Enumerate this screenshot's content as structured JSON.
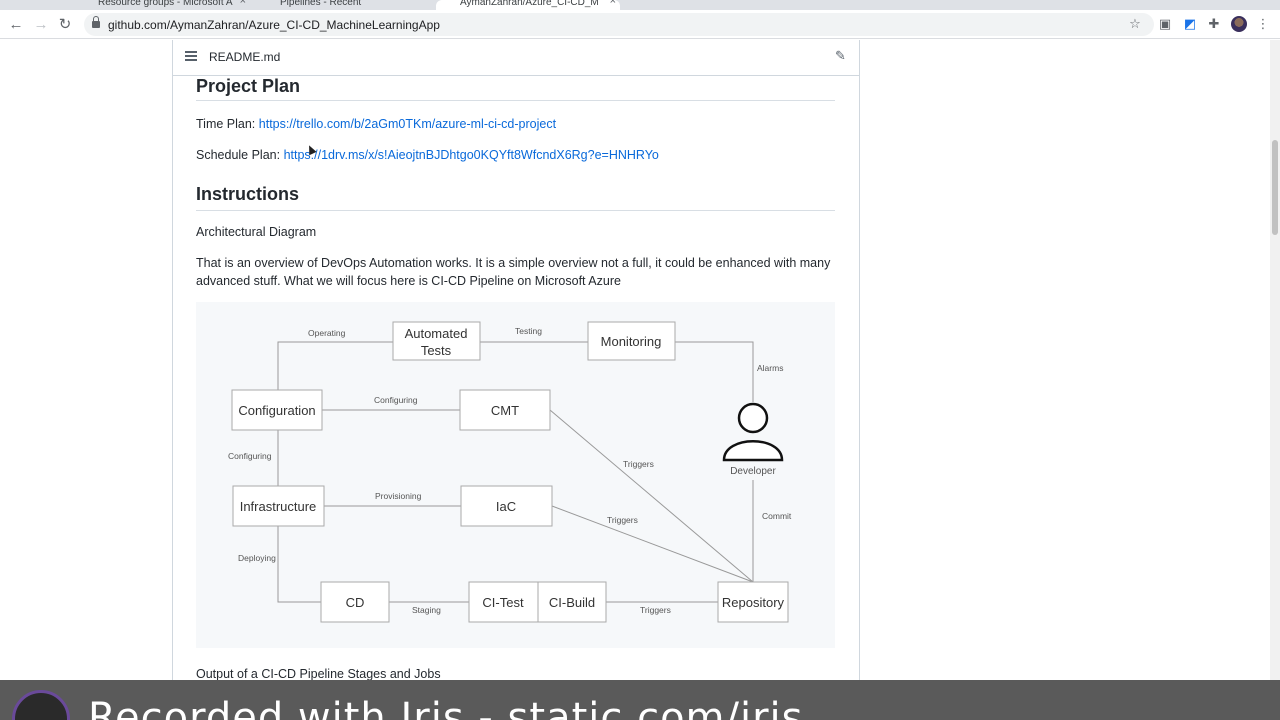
{
  "tabs": [
    {
      "label": "Resource groups - Microsoft A"
    },
    {
      "label": "Pipelines - Recent"
    },
    {
      "label": "AymanZahran/Azure_CI-CD_M"
    }
  ],
  "browser": {
    "url": "github.com/AymanZahran/Azure_CI-CD_MachineLearningApp"
  },
  "readme": {
    "filename": "README.md"
  },
  "sections": {
    "project_plan_heading": "Project Plan",
    "time_plan_label": "Time Plan: ",
    "time_plan_link": "https://trello.com/b/2aGm0TKm/azure-ml-ci-cd-project",
    "schedule_plan_label": "Schedule Plan: ",
    "schedule_plan_link": "https://1drv.ms/x/s!AieojtnBJDhtgo0KQYft8WfcndX6Rg?e=HNHRYo",
    "instructions_heading": "Instructions",
    "arch_diagram_label": "Architectural Diagram",
    "overview_text": "That is an overview of DevOps Automation works. It is a simple overview not a full, it could be enhanced with many advanced stuff. What we will focus here is CI-CD Pipeline on Microsoft Azure",
    "output_label": "Output of a CI-CD Pipeline Stages and Jobs"
  },
  "diagram": {
    "nodes": {
      "automated_tests_1": "Automated",
      "automated_tests_2": "Tests",
      "monitoring": "Monitoring",
      "configuration": "Configuration",
      "cmt": "CMT",
      "developer": "Developer",
      "infrastructure": "Infrastructure",
      "iac": "IaC",
      "cd": "CD",
      "ci_test": "CI-Test",
      "ci_build": "CI-Build",
      "repository": "Repository"
    },
    "edges": {
      "operating": "Operating",
      "testing": "Testing",
      "alarms": "Alarms",
      "configuring_1": "Configuring",
      "configuring_2": "Configuring",
      "triggers_1": "Triggers",
      "triggers_2": "Triggers",
      "triggers_3": "Triggers",
      "provisioning": "Provisioning",
      "commit": "Commit",
      "deploying": "Deploying",
      "staging": "Staging"
    }
  },
  "banner": {
    "text": "Recorded with Iris - static.com/iris"
  }
}
